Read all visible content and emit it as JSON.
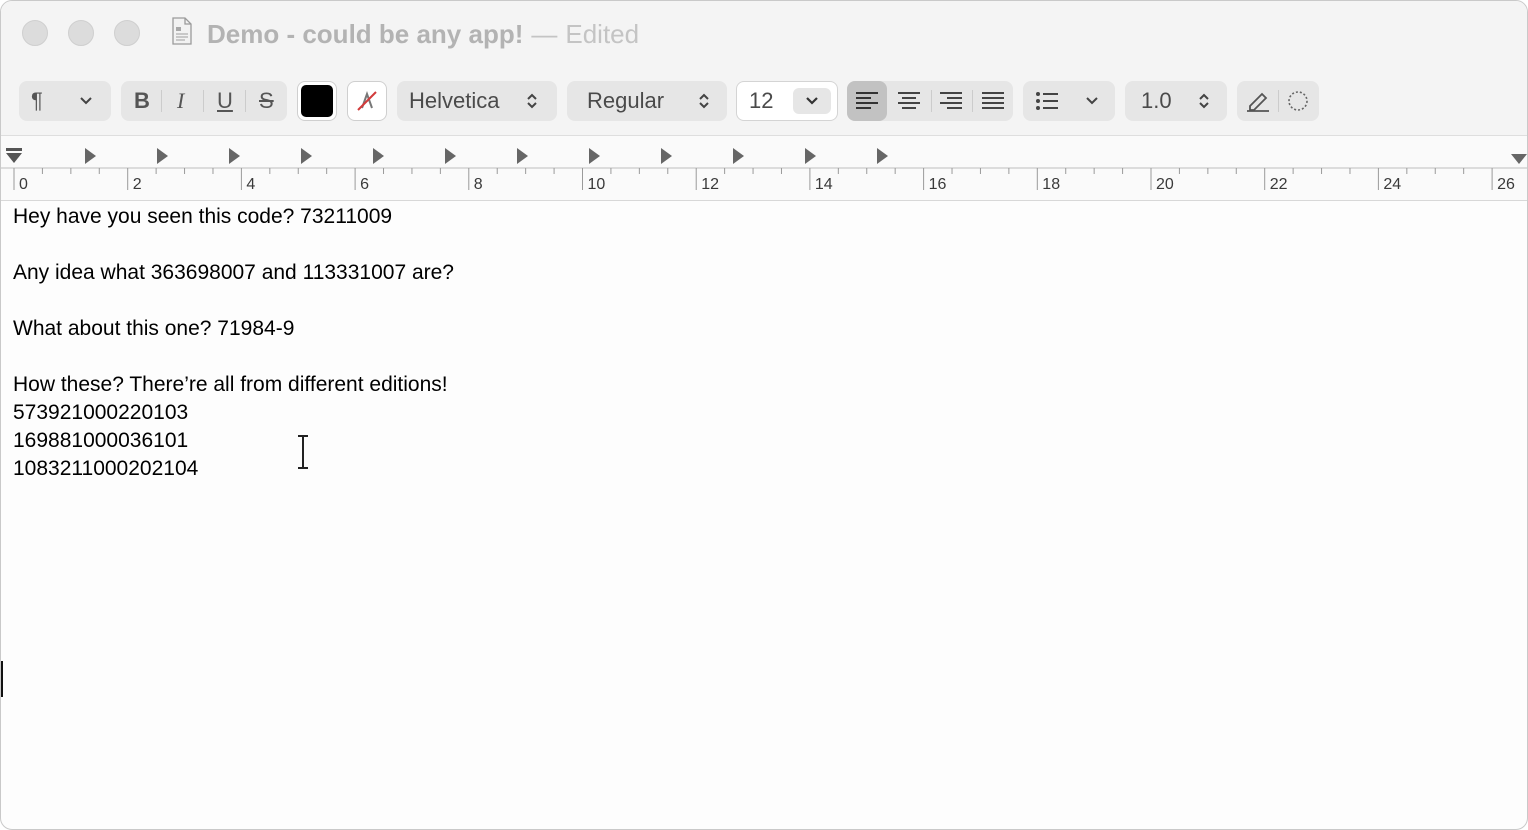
{
  "window": {
    "title": "Demo - could be any app!",
    "title_separator": "—",
    "status": "Edited"
  },
  "toolbar": {
    "paragraph_style_icon": "¶",
    "bold_label": "B",
    "italic_label": "I",
    "underline_label": "U",
    "strikethrough_label": "S",
    "text_color": "#000000",
    "font_family": "Helvetica",
    "font_style": "Regular",
    "font_size": "12",
    "line_spacing": "1.0",
    "alignment_selected": "left"
  },
  "ruler": {
    "labels": [
      "0",
      "2",
      "4",
      "6",
      "8",
      "10",
      "12",
      "14",
      "16",
      "18",
      "20",
      "22",
      "24",
      "26"
    ]
  },
  "document": {
    "lines": [
      "Hey have you seen this code? 73211009",
      "",
      "Any idea what 363698007 and 113331007 are?",
      "",
      "What about this one? 71984-9",
      "",
      "How these? There’re all from different editions!",
      "573921000220103",
      "169881000036101",
      "1083211000202104"
    ]
  }
}
